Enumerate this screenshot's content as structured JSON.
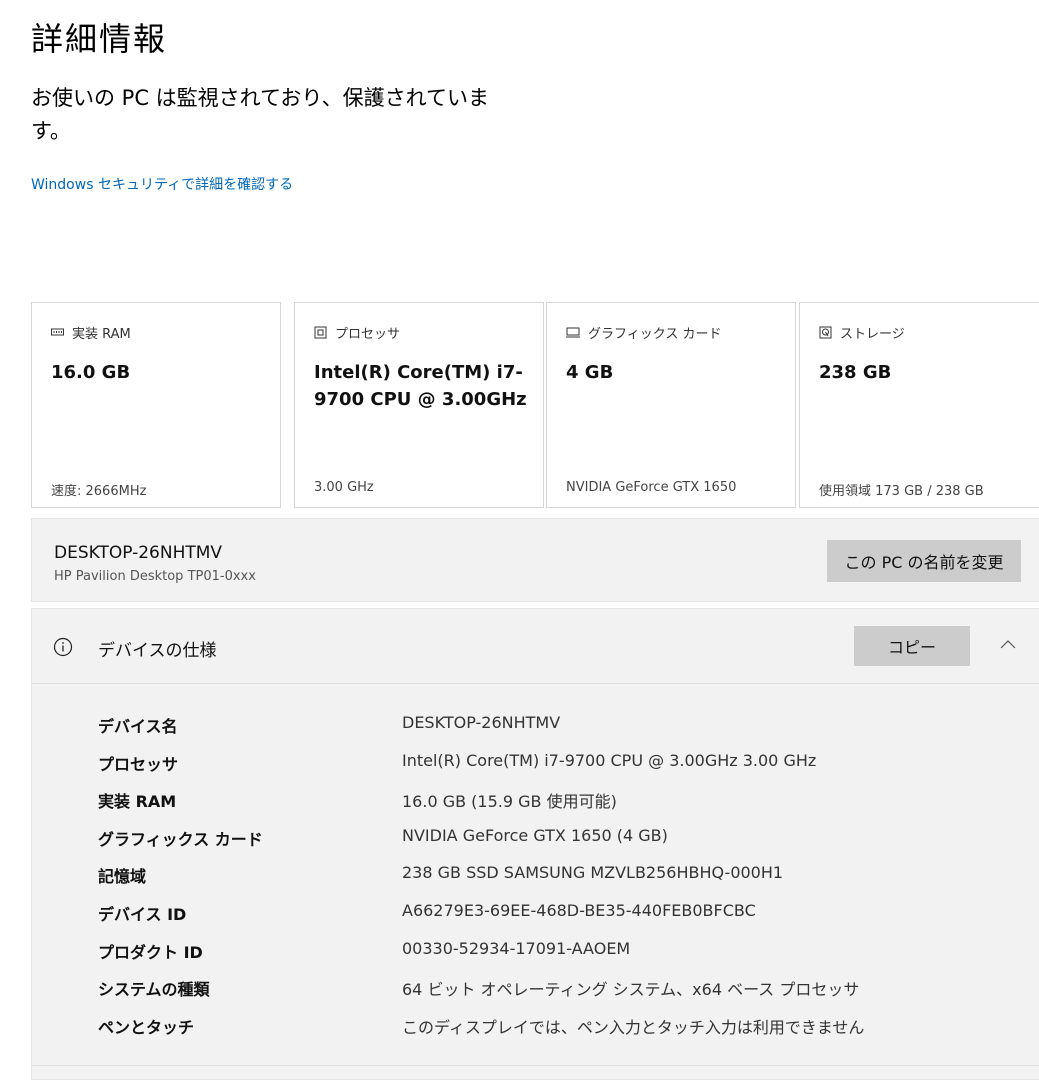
{
  "header": {
    "title": "詳細情報",
    "status": "お使いの PC は監視されており、保護されています。",
    "security_link": "Windows セキュリティで詳細を確認する"
  },
  "cards": [
    {
      "icon": "ram-icon",
      "title": "実装 RAM",
      "value": "16.0 GB",
      "footer": "速度: 2666MHz"
    },
    {
      "icon": "processor-icon",
      "title": "プロセッサ",
      "value": "Intel(R) Core(TM) i7-9700 CPU @ 3.00GHz",
      "footer": "3.00 GHz"
    },
    {
      "icon": "graphics-card-icon",
      "title": "グラフィックス カード",
      "value": "4 GB",
      "footer": "NVIDIA GeForce GTX 1650"
    },
    {
      "icon": "storage-icon",
      "title": "ストレージ",
      "value": "238 GB",
      "footer": "使用領域 173 GB / 238 GB"
    }
  ],
  "device": {
    "name": "DESKTOP-26NHTMV",
    "model": "HP Pavilion Desktop TP01-0xxx",
    "rename_label": "この PC の名前を変更"
  },
  "specs": {
    "title": "デバイスの仕様",
    "copy_label": "コピー",
    "rows": [
      {
        "label": "デバイス名",
        "value": "DESKTOP-26NHTMV"
      },
      {
        "label": "プロセッサ",
        "value": "Intel(R) Core(TM) i7-9700 CPU @ 3.00GHz   3.00 GHz"
      },
      {
        "label": "実装 RAM",
        "value": "16.0 GB (15.9 GB 使用可能)"
      },
      {
        "label": "グラフィックス カード",
        "value": "NVIDIA GeForce GTX 1650 (4 GB)"
      },
      {
        "label": "記憶域",
        "value": "238 GB SSD SAMSUNG MZVLB256HBHQ-000H1"
      },
      {
        "label": "デバイス ID",
        "value": "A66279E3-69EE-468D-BE35-440FEB0BFCBC"
      },
      {
        "label": "プロダクト ID",
        "value": "00330-52934-17091-AAOEM"
      },
      {
        "label": "システムの種類",
        "value": "64 ビット オペレーティング システム、x64 ベース プロセッサ"
      },
      {
        "label": "ペンとタッチ",
        "value": "このディスプレイでは、ペン入力とタッチ入力は利用できません"
      }
    ]
  },
  "colors": {
    "accent_link": "#0067b8",
    "button_bg": "#cccccc",
    "panel_bg": "#f2f2f2"
  }
}
